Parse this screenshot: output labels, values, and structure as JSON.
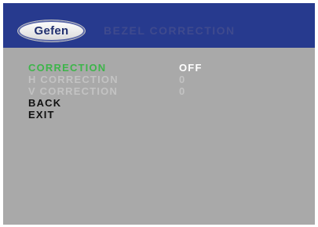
{
  "header": {
    "logo_text": "Gefen",
    "title": "BEZEL CORRECTION"
  },
  "menu": {
    "items": [
      {
        "label": "CORRECTION",
        "value": "OFF",
        "state": "selected"
      },
      {
        "label": "H CORRECTION",
        "value": "0",
        "state": "disabled"
      },
      {
        "label": "V CORRECTION",
        "value": "0",
        "state": "disabled"
      },
      {
        "label": "BACK",
        "value": "",
        "state": "normal"
      },
      {
        "label": "EXIT",
        "value": "",
        "state": "normal"
      }
    ]
  },
  "colors": {
    "header_bg": "#273a8e",
    "screen_bg": "#a9a9a9",
    "selected": "#3db54a",
    "disabled": "#c3c3c3",
    "normal": "#111111"
  }
}
